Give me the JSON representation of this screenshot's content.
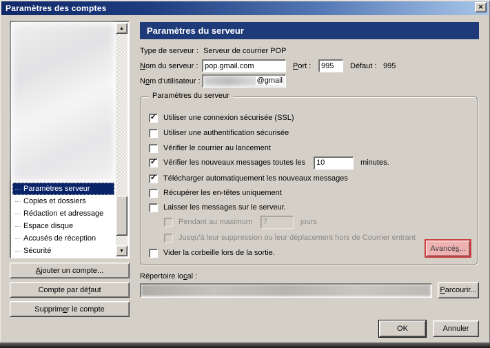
{
  "window": {
    "title": "Paramètres des comptes"
  },
  "icons": {
    "close": "✕",
    "scroll_up": "▲",
    "scroll_down": "▼",
    "check": "✓"
  },
  "colors": {
    "dialog_bg": "#d4d0c8",
    "titlebar_start": "#10296a",
    "titlebar_end": "#a9c7ea",
    "header_bg": "#1f3a78",
    "selection_bg": "#0a246a",
    "highlight_border": "#c94040",
    "highlight_fill": "#efb2b2"
  },
  "sidebar": {
    "tree": [
      {
        "label": "Paramètres serveur",
        "selected": true
      },
      {
        "label": "Copies et dossiers",
        "selected": false
      },
      {
        "label": "Rédaction et adressage",
        "selected": false
      },
      {
        "label": "Espace disque",
        "selected": false
      },
      {
        "label": "Accusés de réception",
        "selected": false
      },
      {
        "label": "Sécurité",
        "selected": false
      }
    ],
    "buttons": {
      "add": "_Ajouter un compte...",
      "set_default": "Compte par dé_faut",
      "remove": "Supprim_er le compte"
    }
  },
  "main": {
    "header": "Paramètres du serveur",
    "server_type_label": "Type de serveur :",
    "server_type_value": "Serveur de courrier POP",
    "server_name_label": "_Nom du serveur :",
    "server_name_value": "pop.gmail.com",
    "port_label": "_Port :",
    "port_value": "995",
    "port_default_label": "Défaut :",
    "port_default_value": "995",
    "username_label": "N_om d'utilisateur :",
    "username_visible": "@gmail",
    "group": {
      "legend": "Paramètres du serveur",
      "rows": [
        {
          "label": "Utiliser une connexion sécurisée (SSL)",
          "checked": true,
          "disabled": false
        },
        {
          "label": "Utiliser une authentification sécurisée",
          "checked": false,
          "disabled": false
        },
        {
          "label": "Vérifier le courrier au lancement",
          "checked": false,
          "disabled": false
        },
        {
          "label": "Vérifier les nouveaux messages toutes les",
          "value": "10",
          "suffix": "minutes.",
          "checked": true,
          "disabled": false
        },
        {
          "label": "Télécharger automatiquement les nouveaux messages",
          "checked": true,
          "disabled": false
        },
        {
          "label": "Récupérer les en-têtes uniquement",
          "checked": false,
          "disabled": false
        },
        {
          "label": "Laisser les messages sur le serveur.",
          "checked": false,
          "disabled": false
        },
        {
          "label": "Pendant au maximum",
          "value": "7",
          "suffix": "jours",
          "checked": false,
          "disabled": true
        },
        {
          "label": "Jusqu'à leur suppression ou leur déplacement hors de Courrier entrant",
          "checked": false,
          "disabled": true
        },
        {
          "label": "Vider la corbeille lors de la sortie.",
          "checked": false,
          "disabled": false
        }
      ],
      "advanced_label": "Avancé_s..."
    },
    "local_dir_label": "Répertoire lo_cal :",
    "browse_label": "_Parcourir...",
    "ok_label": "OK",
    "cancel_label": "Annuler"
  }
}
